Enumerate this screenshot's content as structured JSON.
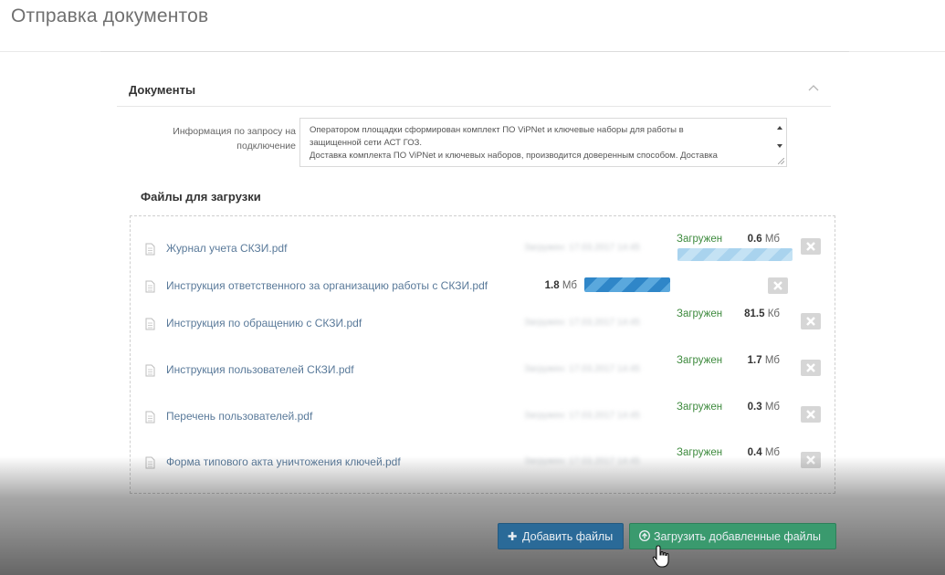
{
  "page": {
    "title": "Отправка документов"
  },
  "documents_panel": {
    "title": "Документы",
    "info_label_lines": [
      "Информация по запросу на",
      "подключение"
    ],
    "info_text_lines": [
      "Оператором площадки сформирован комплект ПО ViPNet и ключевые наборы для работы в",
      "защищенной сети АСТ ГОЗ.",
      "Доставка комплекта ПО ViPNet и ключевых наборов, производится доверенным способом. Доставка"
    ]
  },
  "files_section": {
    "title": "Файлы для загрузки",
    "files": [
      {
        "name": "Журнал учета СКЗИ.pdf",
        "date": "Загружен: 17.03.2017 14:45",
        "status": "Загружен",
        "size_value": "0.6",
        "size_unit": "Мб",
        "state": "done",
        "progress": 1.0
      },
      {
        "name": "Инструкция ответственного за организацию работы с СКЗИ.pdf",
        "date": "",
        "status": "",
        "size_value": "1.8",
        "size_unit": "Мб",
        "state": "uploading",
        "progress": 1.0
      },
      {
        "name": "Инструкция по обращению с СКЗИ.pdf",
        "date": "Загружен: 17.03.2017 14:45",
        "status": "Загружен",
        "size_value": "81.5",
        "size_unit": "Кб",
        "state": "done",
        "progress": 1.0
      },
      {
        "name": "Инструкция пользователей СКЗИ.pdf",
        "date": "Загружен: 17.03.2017 14:45",
        "status": "Загружен",
        "size_value": "1.7",
        "size_unit": "Мб",
        "state": "done",
        "progress": 1.0
      },
      {
        "name": "Перечень пользователей.pdf",
        "date": "Загружен: 17.03.2017 14:45",
        "status": "Загружен",
        "size_value": "0.3",
        "size_unit": "Мб",
        "state": "done",
        "progress": 1.0
      },
      {
        "name": "Форма типового акта уничтожения ключей.pdf",
        "date": "Загружен: 17.03.2017 14:45",
        "status": "Загружен",
        "size_value": "0.4",
        "size_unit": "Мб",
        "state": "done",
        "progress": 1.0
      }
    ]
  },
  "actions": {
    "add_label": "Добавить файлы",
    "upload_label": "Загрузить добавленные файлы"
  },
  "icons": {
    "collapse": "chevron-up-icon",
    "file": "file-icon",
    "remove": "close-icon",
    "add": "plus-icon",
    "upload": "upload-circle-icon",
    "cursor": "hand-pointer-icon"
  },
  "colors": {
    "status_done": "#3d8a3d",
    "btn_add": "#2a6a98",
    "btn_upload": "#3a9a6e",
    "progress": "#2f86c8"
  }
}
